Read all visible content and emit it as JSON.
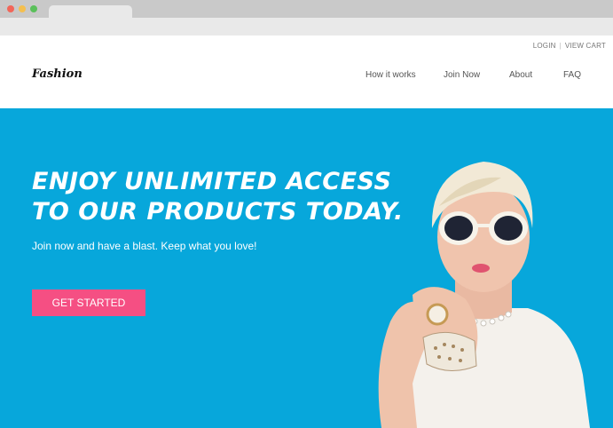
{
  "browser": {
    "tab_count": 1
  },
  "header": {
    "topbar": {
      "login_label": "LOGIN",
      "separator": "|",
      "cart_label": "VIEW CART"
    },
    "logo": "Fashion",
    "nav": [
      {
        "label": "How it works"
      },
      {
        "label": "Join Now"
      },
      {
        "label": "About"
      },
      {
        "label": "FAQ"
      }
    ]
  },
  "hero": {
    "headline_line1": "ENJOY UNLIMITED ACCESS",
    "headline_line2": "TO OUR PRODUCTS TODAY.",
    "subline": "Join now and have a blast. Keep what you love!",
    "cta_label": "GET STARTED",
    "background_color": "#07a7db",
    "cta_color": "#f54f83"
  }
}
